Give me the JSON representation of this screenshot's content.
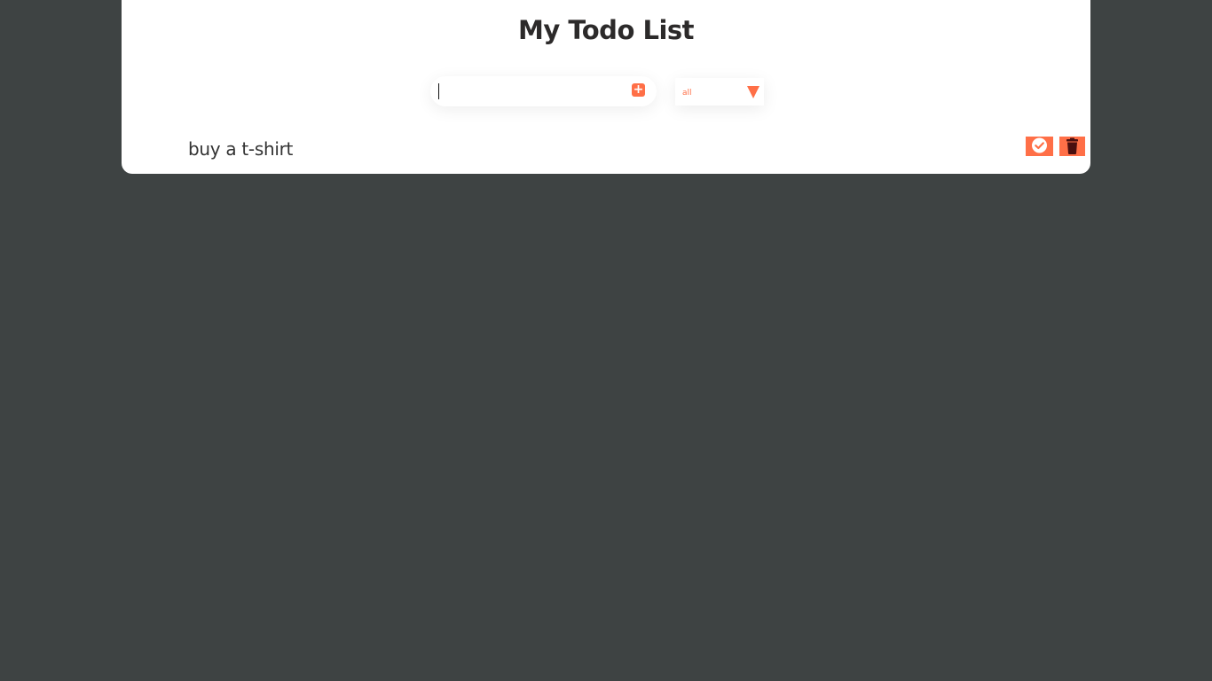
{
  "header": {
    "title": "My Todo List"
  },
  "todo_input": {
    "value": "",
    "add_icon": "plus-square-icon"
  },
  "filter": {
    "selected": "all",
    "arrow_icon": "triangle-down-icon"
  },
  "todos": [
    {
      "text": "buy a t-shirt",
      "complete_icon": "check-circle-icon",
      "delete_icon": "trash-icon"
    }
  ],
  "colors": {
    "background": "#3e4343",
    "card": "#ffffff",
    "accent": "#ff6f47",
    "title": "#2c2a2a",
    "trash_glyph": "#4a0f0f"
  }
}
